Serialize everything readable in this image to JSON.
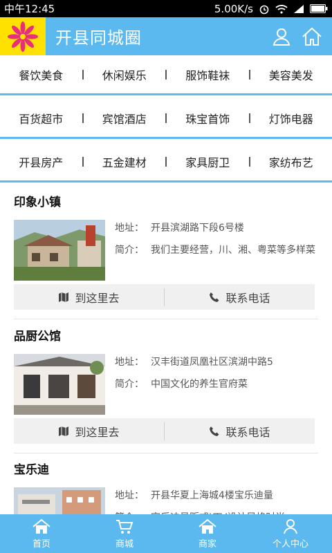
{
  "status_bar": {
    "time": "中午12:45",
    "speed": "5.00K/s"
  },
  "header": {
    "title": "开县同城圈"
  },
  "categories": [
    [
      "餐饮美食",
      "休闲娱乐",
      "服饰鞋袜",
      "美容美发"
    ],
    [
      "百货超市",
      "宾馆酒店",
      "珠宝首饰",
      "灯饰电器"
    ],
    [
      "开县房产",
      "五金建材",
      "家具厨卫",
      "家纺布艺"
    ]
  ],
  "labels": {
    "address": "地址：",
    "intro": "简介：",
    "navigate": "到这里去",
    "call": "联系电话"
  },
  "shops": [
    {
      "name": "印象小镇",
      "address": "开县滨湖路下段6号楼",
      "intro": "我们主要经营，川、湘、粤菜等多样菜"
    },
    {
      "name": "品厨公馆",
      "address": "汉丰街道凤凰社区滨湖中路5",
      "intro": "中国文化的养生官府菜"
    },
    {
      "name": "宝乐迪",
      "address": "开县华夏上海城4楼宝乐迪量",
      "intro": "宝乐迪量贩式KTV设计风格时尚"
    }
  ],
  "tabs": [
    {
      "label": "首页",
      "icon": "home-icon"
    },
    {
      "label": "商城",
      "icon": "cart-icon"
    },
    {
      "label": "商家",
      "icon": "shop-icon"
    },
    {
      "label": "个人中心",
      "icon": "user-icon"
    }
  ],
  "colors": {
    "brand": "#5bb9ef",
    "logo_bg": "#ffe100",
    "logo_flower": "#e8307a"
  }
}
